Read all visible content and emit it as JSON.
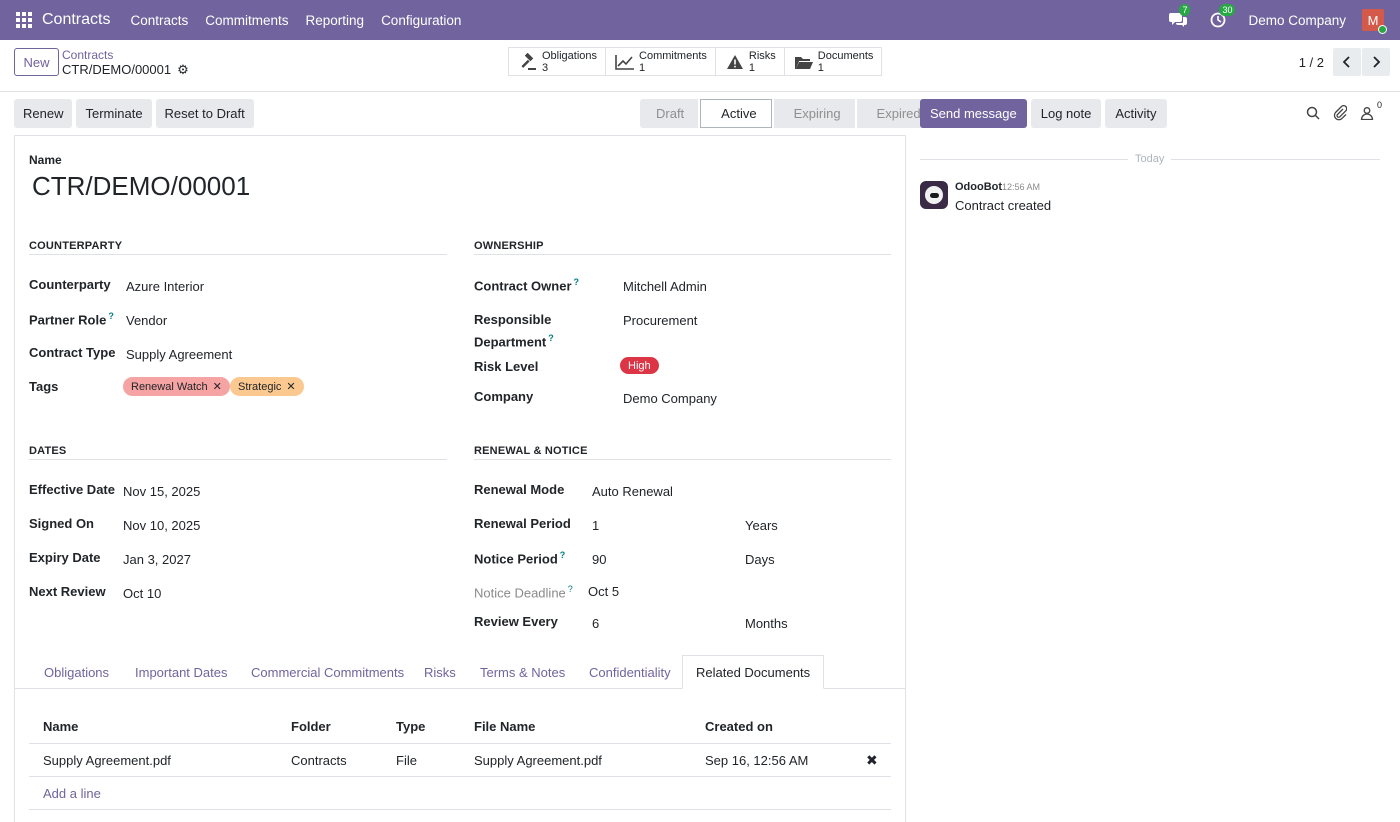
{
  "navbar": {
    "brand": "Contracts",
    "menu": [
      "Contracts",
      "Commitments",
      "Reporting",
      "Configuration"
    ],
    "messages_count": "7",
    "activities_count": "30",
    "company": "Demo Company",
    "avatar_initial": "M"
  },
  "control": {
    "new_label": "New",
    "breadcrumb_parent": "Contracts",
    "breadcrumb_current": "CTR/DEMO/00001",
    "smart_buttons": [
      {
        "label": "Obligations",
        "count": "3"
      },
      {
        "label": "Commitments",
        "count": "1"
      },
      {
        "label": "Risks",
        "count": "1"
      },
      {
        "label": "Documents",
        "count": "1"
      }
    ],
    "pager": "1 / 2"
  },
  "statusbar": {
    "buttons": [
      "Renew",
      "Terminate",
      "Reset to Draft"
    ],
    "stages": [
      "Draft",
      "Active",
      "Expiring",
      "Expired"
    ]
  },
  "chatter": {
    "send_message": "Send message",
    "log_note": "Log note",
    "activity": "Activity",
    "followers_count": "0",
    "today": "Today",
    "author": "OdooBot",
    "time": "12:56 AM",
    "message": "Contract created"
  },
  "form": {
    "name_label": "Name",
    "name_value": "CTR/DEMO/00001",
    "counterparty_section": "Counterparty",
    "ownership_section": "Ownership",
    "dates_section": "Dates",
    "renewal_section": "Renewal & Notice",
    "fields": {
      "counterparty": {
        "label": "Counterparty",
        "value": "Azure Interior"
      },
      "partner_role": {
        "label": "Partner Role",
        "value": "Vendor"
      },
      "contract_type": {
        "label": "Contract Type",
        "value": "Supply Agreement"
      },
      "tags": {
        "label": "Tags",
        "values": [
          "Renewal Watch",
          "Strategic"
        ]
      },
      "contract_owner": {
        "label": "Contract Owner",
        "value": "Mitchell Admin"
      },
      "responsible_department": {
        "label_1": "Responsible",
        "label_2": "Department",
        "value": "Procurement"
      },
      "risk_level": {
        "label": "Risk Level",
        "value": "High"
      },
      "company": {
        "label": "Company",
        "value": "Demo Company"
      },
      "effective_date": {
        "label": "Effective Date",
        "value": "Nov 15, 2025"
      },
      "signed_on": {
        "label": "Signed On",
        "value": "Nov 10, 2025"
      },
      "expiry_date": {
        "label": "Expiry Date",
        "value": "Jan 3, 2027"
      },
      "next_review": {
        "label": "Next Review",
        "value": "Oct 10"
      },
      "renewal_mode": {
        "label": "Renewal Mode",
        "value": "Auto Renewal"
      },
      "renewal_period": {
        "label": "Renewal Period",
        "value": "1",
        "unit": "Years"
      },
      "notice_period": {
        "label": "Notice Period",
        "value": "90",
        "unit": "Days"
      },
      "notice_deadline": {
        "label": "Notice Deadline",
        "value": "Oct 5"
      },
      "review_every": {
        "label": "Review Every",
        "value": "6",
        "unit": "Months"
      }
    },
    "help_mark": "?"
  },
  "tabs": [
    "Obligations",
    "Important Dates",
    "Commercial Commitments",
    "Risks",
    "Terms & Notes",
    "Confidentiality",
    "Related Documents"
  ],
  "documents_table": {
    "headers": [
      "Name",
      "Folder",
      "Type",
      "File Name",
      "Created on"
    ],
    "rows": [
      {
        "name": "Supply Agreement.pdf",
        "folder": "Contracts",
        "type": "File",
        "file_name": "Supply Agreement.pdf",
        "created_on": "Sep 16, 12:56 AM"
      }
    ],
    "add_line": "Add a line"
  },
  "colors": {
    "brand": "#71639e",
    "danger": "#dc3545",
    "tag_red": "#f6a3a3",
    "tag_orange": "#fbc88f",
    "success": "#28a745"
  }
}
